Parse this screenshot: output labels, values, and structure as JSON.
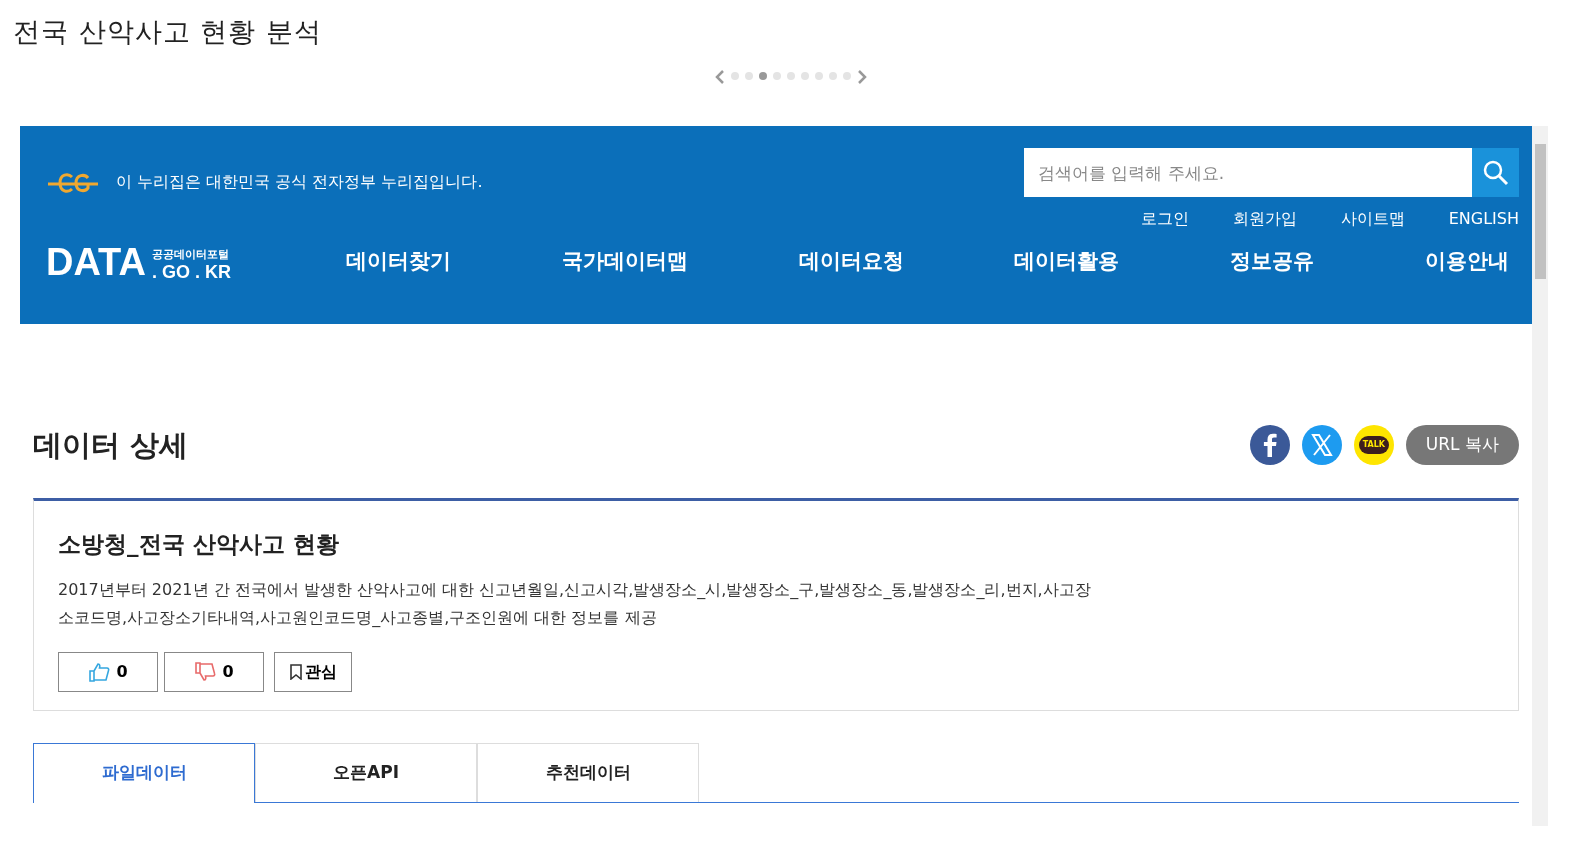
{
  "page_title": "전국 산악사고 현황 분석",
  "carousel": {
    "dots": [
      {
        "selected": false
      },
      {
        "selected": false
      },
      {
        "selected": true
      },
      {
        "selected": false
      },
      {
        "selected": false
      },
      {
        "selected": false
      },
      {
        "selected": false
      },
      {
        "selected": false
      },
      {
        "selected": false
      }
    ]
  },
  "header": {
    "notice": "이 누리집은 대한민국 공식 전자정부 누리집입니다.",
    "search": {
      "placeholder": "검색어를 입력해 주세요."
    },
    "util_links": [
      "로그인",
      "회원가입",
      "사이트맵",
      "ENGLISH"
    ],
    "logo": {
      "main": "DATA",
      "sub": "공공데이터포털",
      "domain": ". GO . KR"
    },
    "nav": [
      "데이터찾기",
      "국가데이터맵",
      "데이터요청",
      "데이터활용",
      "정보공유",
      "이용안내"
    ]
  },
  "section_title": "데이터 상세",
  "share": {
    "kakao_label": "TALK",
    "url_button": "URL 복사"
  },
  "dataset": {
    "title": "소방청_전국 산악사고 현황",
    "description": [
      "2017년부터 2021년 간 전국에서 발생한 산악사고에 대한 신고년월일,신고시각,발생장소_시,발생장소_구,발생장소_동,발생장소_리,번지,사고장",
      "소코드명,사고장소기타내역,사고원인코드명_사고종별,구조인원에 대한 정보를 제공"
    ],
    "likes": "0",
    "dislikes": "0",
    "bookmark": "관심"
  },
  "tabs": [
    {
      "label": "파일데이터",
      "selected": true
    },
    {
      "label": "오픈API",
      "selected": false
    },
    {
      "label": "추천데이터",
      "selected": false
    }
  ]
}
